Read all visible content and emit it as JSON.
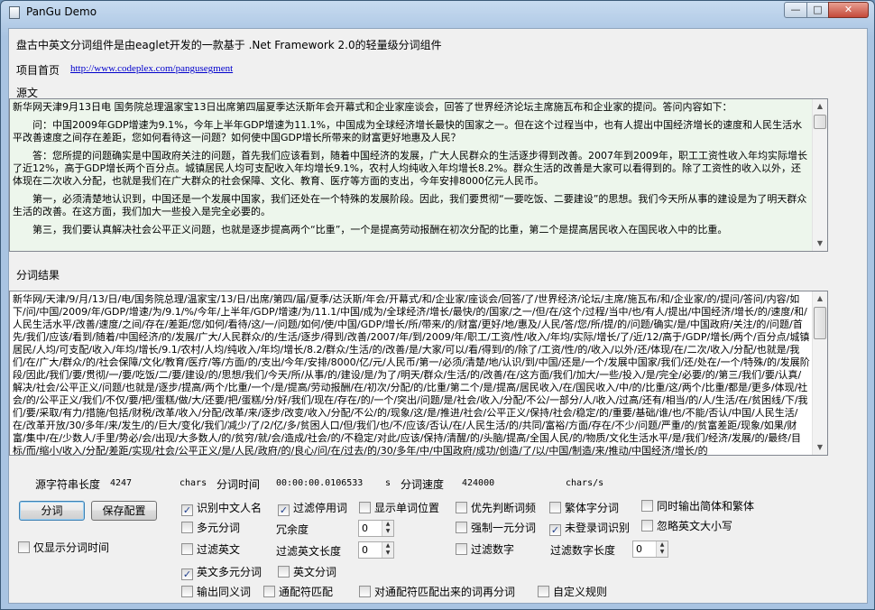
{
  "window": {
    "title": "PanGu Demo",
    "min": "—",
    "max": "□",
    "close": "✕"
  },
  "header": {
    "intro": "盘古中英文分词组件是由eaglet开发的一款基于 .Net Framework 2.0的轻量级分词组件",
    "homepage_label": "项目首页",
    "homepage_url": "http://www.codeplex.com/pangusegment"
  },
  "source": {
    "label": "源文",
    "paragraphs": [
      "新华网天津9月13日电 国务院总理温家宝13日出席第四届夏季达沃斯年会开幕式和企业家座谈会，回答了世界经济论坛主席施瓦布和企业家的提问。答问内容如下：",
      "问：中国2009年GDP增速为9.1%，今年上半年GDP增速为11.1%，中国成为全球经济增长最快的国家之一。但在这个过程当中，也有人提出中国经济增长的速度和人民生活水平改善速度之间存在差距，您如何看待这一问题？如何使中国GDP增长所带来的财富更好地惠及人民？",
      "答：您所提的问题确实是中国政府关注的问题，首先我们应该看到，随着中国经济的发展，广大人民群众的生活逐步得到改善。2007年到2009年，职工工资性收入年均实际增长了近12%，高于GDP增长两个百分点。城镇居民人均可支配收入年均增长9.1%，农村人均纯收入年均增长8.2%。群众生活的改善是大家可以看得到的。除了工资性的收入以外，还体现在二次收入分配，也就是我们在广大群众的社会保障、文化、教育、医疗等方面的支出，今年安排8000亿元人民币。",
      "第一，必须清楚地认识到，中国还是一个发展中国家，我们还处在一个特殊的发展阶段。因此，我们要贯彻“一要吃饭、二要建设”的思想。我们今天所从事的建设是为了明天群众生活的改善。在这方面，我们加大一些投入是完全必要的。",
      "第三，我们要认真解决社会公平正义问题，也就是逐步提高两个“比重”，一个是提高劳动报酬在初次分配的比重，第二个是提高居民收入在国民收入中的比重。"
    ]
  },
  "result": {
    "label": "分词结果",
    "text": "新华网/天津/9/月/13/日/电/国务院总理/温家宝/13/日/出席/第四/届/夏季/达沃斯/年会/开幕式/和/企业家/座谈会/回答/了/世界经济/论坛/主席/施瓦布/和/企业家/的/提问/答问/内容/如下/问/中国/2009/年/GDP/增速/为/9.1/%/今年/上半年/GDP/增速/为/11.1/中国/成为/全球经济/增长/最快/的/国家/之一/但/在/这个/过程/当中/也/有人/提出/中国经济/增长/的/速度/和/人民生活水平/改善/速度/之间/存在/差距/您/如何/看待/这/一/问题/如何/使/中国/GDP/增长/所/带来/的/财富/更好/地/惠及/人民/答/您/所/提/的/问题/确实/是/中国政府/关注/的/问题/首先/我们/应该/看到/随着/中国经济/的/发展/广大/人民群众/的/生活/逐步/得到/改善/2007/年/到/2009/年/职工/工资/性/收入/年均/实际/增长/了/近/12/高于/GDP/增长/两个/百分点/城镇居民/人均/可支配/收入/年均/增长/9.1/农村/人均/纯收入/年均/增长/8.2/群众/生活/的/改善/是/大家/可以/看/得到/的/除了/工资/性/的/收入/以外/还/体现/在/二次/收入/分配/也就是/我们/在/广大/群众/的/社会保障/文化/教育/医疗/等/方面/的/支出/今年/安排/8000/亿/元/人民币/第一/必须/清楚/地/认识/到/中国/还是/一个/发展中国家/我们/还/处在/一个/特殊/的/发展阶段/因此/我们/要/贯彻/一/要/吃饭/二/要/建设/的/思想/我们/今天/所/从事/的/建设/是/为了/明天/群众/生活/的/改善/在/这方面/我们/加大/一些/投入/是/完全/必要/的/第三/我们/要/认真/解决/社会/公平正义/问题/也就是/逐步/提高/两个/比重/一个/是/提高/劳动报酬/在/初次/分配/的/比重/第二个/是/提高/居民收入/在/国民收入/中/的/比重/这/两个/比重/都是/更多/体现/社会/的/公平正义/我们/不仅/要/把/蛋糕/做/大/还要/把/蛋糕/分/好/我们/现在/存在/的/一个/突出/问题/是/社会/收入/分配/不公/一部分/人/收入/过高/还有/相当/的/人/生活/在/贫困线/下/我们/要/采取/有力/措施/包括/财税/改革/收入/分配/改革/来/逐步/改变/收入/分配/不公/的/现象/这/是/推进/社会/公平正义/保持/社会/稳定/的/重要/基础/谁/也/不能/否认/中国/人民生活/在/改革开放/30/多年/来/发生/的/巨大/变化/我们/减少/了/2/亿/多/贫困人口/但/我们/也/不/应该/否认/在/人民生活/的/共同/富裕/方面/存在/不少/问题/严重/的/贫富差距/现象/如果/财富/集中/在/少数人/手里/势必/会/出现/大多数人/的/贫穷/就/会/造成/社会/的/不稳定/对此/应该/保持/清醒/的/头脑/提高/全国人民/的/物质/文化生活水平/是/我们/经济/发展/的/最终/目标/而/缩小/收入/分配/差距/实现/社会/公平正义/是/人民/政府/的/良心/问/在/过去/的/30/多年/中/中国政府/成功/创造/了/以/中国/制造/来/推动/中国经济/增长/的"
  },
  "stats": {
    "source_len_label": "源字符串长度",
    "source_len_value": "4247",
    "source_len_unit": "chars",
    "time_label": "分词时间",
    "time_value": "00:00:00.0106533",
    "time_unit": "s",
    "speed_label": "分词速度",
    "speed_value": "424000",
    "speed_unit": "chars/s"
  },
  "buttons": {
    "segment": "分词",
    "save_config": "保存配置"
  },
  "options": {
    "only_time": {
      "label": "仅显示分词时间",
      "checked": false
    },
    "identify_chinese_names": {
      "label": "识别中文人名",
      "checked": true
    },
    "filter_stopwords": {
      "label": "过滤停用词",
      "checked": true
    },
    "show_word_position": {
      "label": "显示单词位置",
      "checked": false
    },
    "frequency_first": {
      "label": "优先判断词频",
      "checked": false
    },
    "traditional": {
      "label": "繁体字分词",
      "checked": false
    },
    "output_simp_trad": {
      "label": "同时输出简体和繁体",
      "checked": false
    },
    "multi_segment": {
      "label": "多元分词",
      "checked": false
    },
    "redundancy_label": "冗余度",
    "redundancy_value": "0",
    "force_unigram": {
      "label": "强制一元分词",
      "checked": false
    },
    "unknown_words": {
      "label": "未登录词识别",
      "checked": true
    },
    "ignore_case": {
      "label": "忽略英文大小写",
      "checked": false
    },
    "filter_english": {
      "label": "过滤英文",
      "checked": false
    },
    "filter_english_len_label": "过滤英文长度",
    "filter_english_len_value": "0",
    "filter_numeric": {
      "label": "过滤数字",
      "checked": false
    },
    "filter_numeric_len_label": "过滤数字长度",
    "filter_numeric_len_value": "0",
    "english_multi": {
      "label": "英文多元分词",
      "checked": true
    },
    "english_segment": {
      "label": "英文分词",
      "checked": false
    },
    "output_synonym": {
      "label": "输出同义词",
      "checked": false
    },
    "wildcard": {
      "label": "通配符匹配",
      "checked": false
    },
    "wildcard_segment": {
      "label": "对通配符匹配出来的词再分词",
      "checked": false
    },
    "custom_rules": {
      "label": "自定义规则",
      "checked": false
    }
  }
}
